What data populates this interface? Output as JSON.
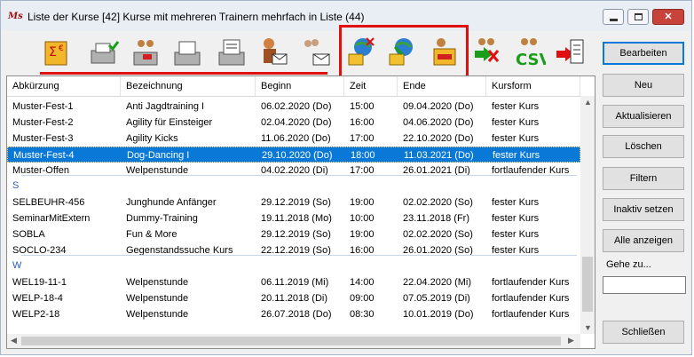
{
  "window": {
    "title": "Liste der Kurse [42] Kurse mit mehreren Trainern mehrfach in Liste (44)",
    "icon_name": "app-logo-icon",
    "controls": {
      "minimize_icon": "minimize-icon",
      "maximize_icon": "maximize-icon",
      "close_icon": "close-icon"
    }
  },
  "toolbar": {
    "buttons": [
      {
        "icon": "sum-euro-icon"
      },
      {
        "icon": "printer-check-icon"
      },
      {
        "icon": "printer-people-icon"
      },
      {
        "icon": "printer-icon"
      },
      {
        "icon": "printer-doc-icon"
      },
      {
        "icon": "person-mail-icon"
      },
      {
        "icon": "group-mail-icon"
      },
      {
        "icon": "course-globe-remove-icon"
      },
      {
        "icon": "course-globe-add-icon"
      },
      {
        "icon": "course-folder-icon"
      },
      {
        "icon": "export-excel-icon"
      },
      {
        "icon": "export-csv-icon",
        "text": "CSV"
      },
      {
        "icon": "export-list-icon"
      }
    ],
    "highlight_color": "#e01010"
  },
  "table": {
    "columns": [
      "Abkürzung",
      "Bezeichnung",
      "Beginn",
      "Zeit",
      "Ende",
      "Kursform"
    ],
    "rows": [
      {
        "kind": "row",
        "cells": [
          "Muster-Fest-1",
          "Anti Jagdtraining I",
          "06.02.2020 (Do)",
          "15:00",
          "09.04.2020 (Do)",
          "fester Kurs"
        ]
      },
      {
        "kind": "row",
        "cells": [
          "Muster-Fest-2",
          "Agility für Einsteiger",
          "02.04.2020 (Do)",
          "16:00",
          "04.06.2020 (Do)",
          "fester Kurs"
        ]
      },
      {
        "kind": "row",
        "cells": [
          "Muster-Fest-3",
          "Agility Kicks",
          "11.06.2020 (Do)",
          "17:00",
          "22.10.2020 (Do)",
          "fester Kurs"
        ]
      },
      {
        "kind": "row",
        "selected": true,
        "cells": [
          "Muster-Fest-4",
          "Dog-Dancing I",
          "29.10.2020 (Do)",
          "18:00",
          "11.03.2021 (Do)",
          "fester Kurs"
        ]
      },
      {
        "kind": "row",
        "cells": [
          "Muster-Offen",
          "Welpenstunde",
          "04.02.2020 (Di)",
          "17:00",
          "26.01.2021 (Di)",
          "fortlaufender Kurs"
        ]
      },
      {
        "kind": "group",
        "label": "S"
      },
      {
        "kind": "row",
        "cells": [
          "SELBEUHR-456",
          "Junghunde Anfänger",
          "29.12.2019 (So)",
          "19:00",
          "02.02.2020 (So)",
          "fester Kurs"
        ]
      },
      {
        "kind": "row",
        "cells": [
          "SeminarMitExtern",
          "Dummy-Training",
          "19.11.2018 (Mo)",
          "10:00",
          "23.11.2018 (Fr)",
          "fester Kurs"
        ]
      },
      {
        "kind": "row",
        "cells": [
          "SOBLA",
          "Fun & More",
          "29.12.2019 (So)",
          "19:00",
          "02.02.2020 (So)",
          "fester Kurs"
        ]
      },
      {
        "kind": "row",
        "cells": [
          "SOCLO-234",
          "Gegenstandssuche Kurs",
          "22.12.2019 (So)",
          "16:00",
          "26.01.2020 (So)",
          "fester Kurs"
        ]
      },
      {
        "kind": "group",
        "label": "W"
      },
      {
        "kind": "row",
        "cells": [
          "WEL19-11-1",
          "Welpenstunde",
          "06.11.2019 (Mi)",
          "14:00",
          "22.04.2020 (Mi)",
          "fortlaufender Kurs"
        ]
      },
      {
        "kind": "row",
        "cells": [
          "WELP-18-4",
          "Welpenstunde",
          "20.11.2018 (Di)",
          "09:00",
          "07.05.2019 (Di)",
          "fortlaufender Kurs"
        ]
      },
      {
        "kind": "row",
        "cells": [
          "WELP2-18",
          "Welpenstunde",
          "26.07.2018 (Do)",
          "08:30",
          "10.01.2019 (Do)",
          "fortlaufender Kurs"
        ]
      }
    ],
    "selection_color": "#0a78d7"
  },
  "side": {
    "buttons": [
      "Bearbeiten",
      "Neu",
      "Aktualisieren",
      "Löschen",
      "Filtern",
      "Inaktiv setzen",
      "Alle anzeigen"
    ],
    "goto_label": "Gehe zu...",
    "goto_value": "",
    "close_button": "Schließen"
  }
}
